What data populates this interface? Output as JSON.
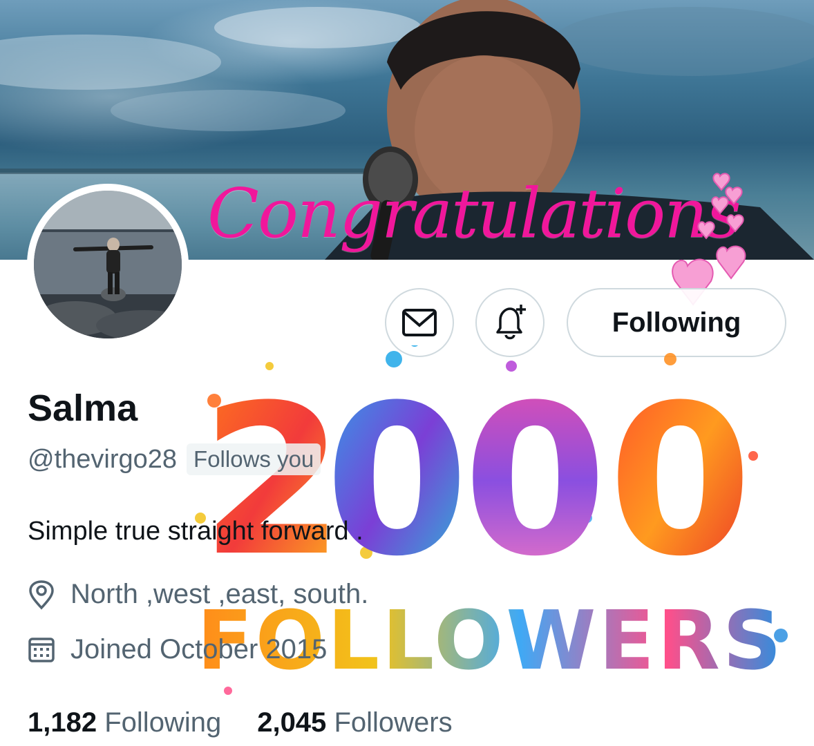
{
  "profile": {
    "name": "Salma",
    "handle": "@thevirgo28",
    "follows_you": "Follows you",
    "bio": "Simple true straight forward .",
    "location": "North ,west ,east, south.",
    "joined": "Joined October 2015"
  },
  "actions": {
    "following_label": "Following"
  },
  "stats": {
    "following_count": "1,182",
    "following_label": "Following",
    "followers_count": "2,045",
    "followers_label": "Followers"
  },
  "banner": {
    "overlay_text": "Congratulations"
  },
  "graphic": {
    "number": "2000",
    "word": "FOLLOWERS"
  },
  "icons": {
    "message": "envelope-icon",
    "notify": "bell-plus-icon",
    "location": "map-pin-icon",
    "joined": "calendar-icon"
  },
  "colors": {
    "accent_pink": "#f0179b",
    "text_primary": "#0f1419",
    "text_secondary": "#536471",
    "border": "#cfd9de"
  }
}
